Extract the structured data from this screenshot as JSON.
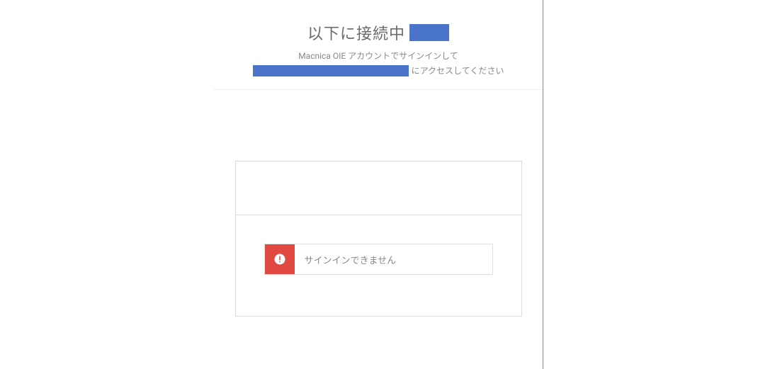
{
  "header": {
    "title": "以下に接続中",
    "subtitle_line1": "Macnica OIE アカウントでサインインして",
    "subtitle_line2_suffix": "にアクセスしてください"
  },
  "error": {
    "message": "サインインできません"
  },
  "colors": {
    "redaction": "#4a74c9",
    "error_bg": "#e0493f"
  }
}
